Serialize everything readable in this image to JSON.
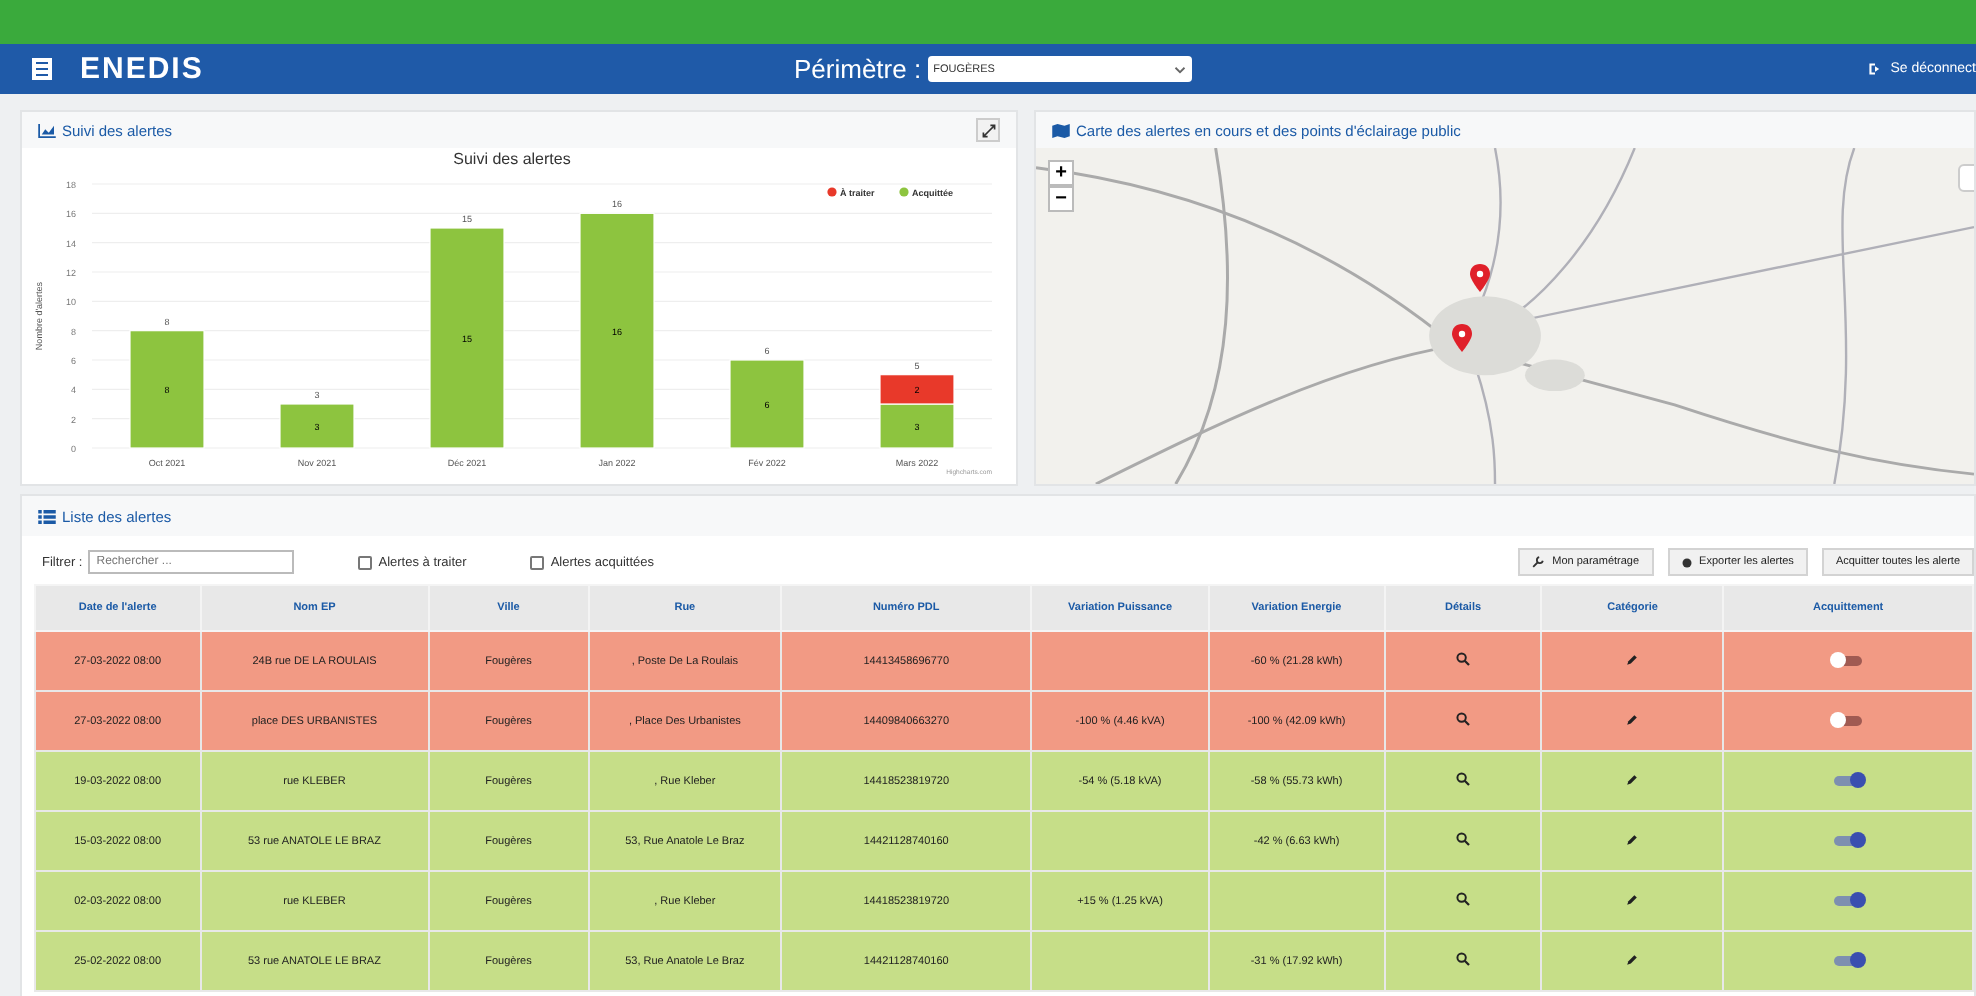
{
  "header": {
    "logo": "ENEDIS",
    "perimeter_label": "Périmètre :",
    "perimeter_value": "FOUGÈRES",
    "logout": "Se déconnect"
  },
  "chart_panel": {
    "title": "Suivi des alertes",
    "credit": "Highcharts.com",
    "chart_data": {
      "type": "bar",
      "title": "Suivi des alertes",
      "ylabel": "Nombre d'alertes",
      "categories": [
        "Oct 2021",
        "Nov 2021",
        "Déc 2021",
        "Jan 2022",
        "Fév 2022",
        "Mars 2022"
      ],
      "stacked": true,
      "grid": true,
      "legend": "top-right",
      "ylim": [
        0,
        18
      ],
      "annotations": [
        {
          "text": "8"
        },
        {
          "text": "3"
        },
        {
          "text": "15"
        },
        {
          "text": "16"
        },
        {
          "text": "6"
        },
        {
          "text": "5"
        }
      ],
      "yticks": [
        0,
        2,
        4,
        6,
        8,
        10,
        12,
        14,
        16,
        18
      ],
      "series": [
        {
          "name": "À traiter",
          "color": "#e8392a",
          "values": [
            0,
            0,
            0,
            0,
            0,
            2
          ],
          "value_labels": [
            null,
            null,
            null,
            null,
            null,
            "2"
          ]
        },
        {
          "name": "Acquittée",
          "color": "#8dc43f",
          "values": [
            8,
            3,
            15,
            16,
            6,
            3
          ],
          "value_labels": [
            "8",
            "3",
            "15",
            "16",
            "6",
            "3"
          ]
        }
      ]
    }
  },
  "map_panel": {
    "title": "Carte des alertes en cours et des points d'éclairage public",
    "zoom_in": "+",
    "zoom_out": "−"
  },
  "list_panel": {
    "title": "Liste des alertes",
    "filter_label": "Filtrer :",
    "search_placeholder": "Rechercher ...",
    "checkboxes": [
      {
        "label": "Alertes à traiter",
        "checked": false
      },
      {
        "label": "Alertes acquittées",
        "checked": false
      }
    ],
    "buttons": [
      {
        "label": "Mon paramétrage",
        "kind": "settings"
      },
      {
        "label": "Exporter les alertes",
        "kind": "export"
      },
      {
        "label": "Acquitter toutes les alerte",
        "kind": "plain"
      }
    ],
    "columns": [
      "Date de l'alerte",
      "Nom EP",
      "Ville",
      "Rue",
      "Numéro PDL",
      "Variation Puissance",
      "Variation Energie",
      "Détails",
      "Catégorie",
      "Acquittement"
    ],
    "rows": [
      {
        "date": "27-03-2022 08:00",
        "nom": "24B rue DE LA ROULAIS",
        "ville": "Fougères",
        "rue": ", Poste De La Roulais",
        "pdl": "14413458696770",
        "puissance": "",
        "energie": "-60 % (21.28 kWh)",
        "acquitted": false
      },
      {
        "date": "27-03-2022 08:00",
        "nom": "place DES URBANISTES",
        "ville": "Fougères",
        "rue": ", Place Des Urbanistes",
        "pdl": "14409840663270",
        "puissance": "-100 % (4.46 kVA)",
        "energie": "-100 % (42.09 kWh)",
        "acquitted": false
      },
      {
        "date": "19-03-2022 08:00",
        "nom": "rue KLEBER",
        "ville": "Fougères",
        "rue": ", Rue Kleber",
        "pdl": "14418523819720",
        "puissance": "-54 % (5.18 kVA)",
        "energie": "-58 % (55.73 kWh)",
        "acquitted": true
      },
      {
        "date": "15-03-2022 08:00",
        "nom": "53 rue ANATOLE LE BRAZ",
        "ville": "Fougères",
        "rue": "53, Rue Anatole Le Braz",
        "pdl": "14421128740160",
        "puissance": "",
        "energie": "-42 % (6.63 kWh)",
        "acquitted": true
      },
      {
        "date": "02-03-2022 08:00",
        "nom": "rue KLEBER",
        "ville": "Fougères",
        "rue": ", Rue Kleber",
        "pdl": "14418523819720",
        "puissance": "+15 % (1.25 kVA)",
        "energie": "",
        "acquitted": true
      },
      {
        "date": "25-02-2022 08:00",
        "nom": "53 rue ANATOLE LE BRAZ",
        "ville": "Fougères",
        "rue": "53, Rue Anatole Le Braz",
        "pdl": "14421128740160",
        "puissance": "",
        "energie": "-31 % (17.92 kWh)",
        "acquitted": true
      }
    ]
  }
}
